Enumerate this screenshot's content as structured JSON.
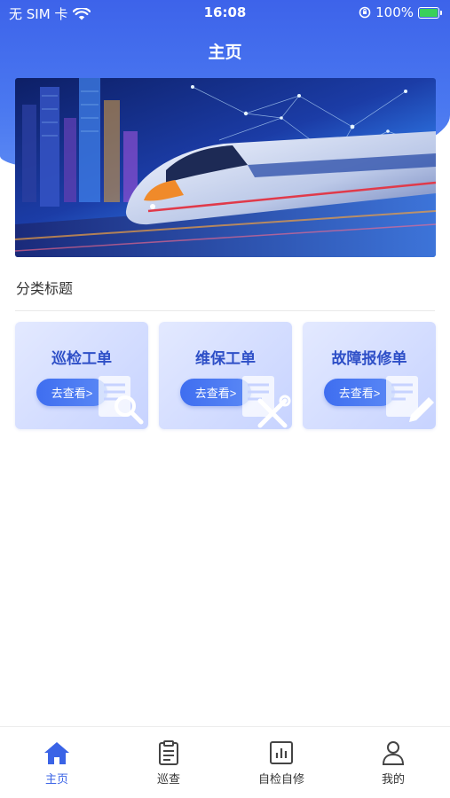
{
  "status_bar": {
    "carrier": "无 SIM 卡",
    "time": "16:08",
    "battery_percent": "100%"
  },
  "header": {
    "title": "主页"
  },
  "banner": {
    "icon": "high-speed-train-image"
  },
  "section": {
    "title": "分类标题"
  },
  "cards": [
    {
      "title": "巡检工单",
      "button_label": "去查看>",
      "icon": "magnifier-icon"
    },
    {
      "title": "维保工单",
      "button_label": "去查看>",
      "icon": "tools-icon"
    },
    {
      "title": "故障报修单",
      "button_label": "去查看>",
      "icon": "pencil-icon"
    }
  ],
  "tab_bar": {
    "items": [
      {
        "label": "主页",
        "icon": "home-icon",
        "active": true
      },
      {
        "label": "巡查",
        "icon": "clipboard-icon",
        "active": false
      },
      {
        "label": "自检自修",
        "icon": "chart-icon",
        "active": false
      },
      {
        "label": "我的",
        "icon": "user-icon",
        "active": false
      }
    ]
  },
  "colors": {
    "accent": "#3a63e6",
    "header_gradient_top": "#3d63ea",
    "card_title": "#2e4fc7",
    "battery_fill": "#39d05a"
  }
}
